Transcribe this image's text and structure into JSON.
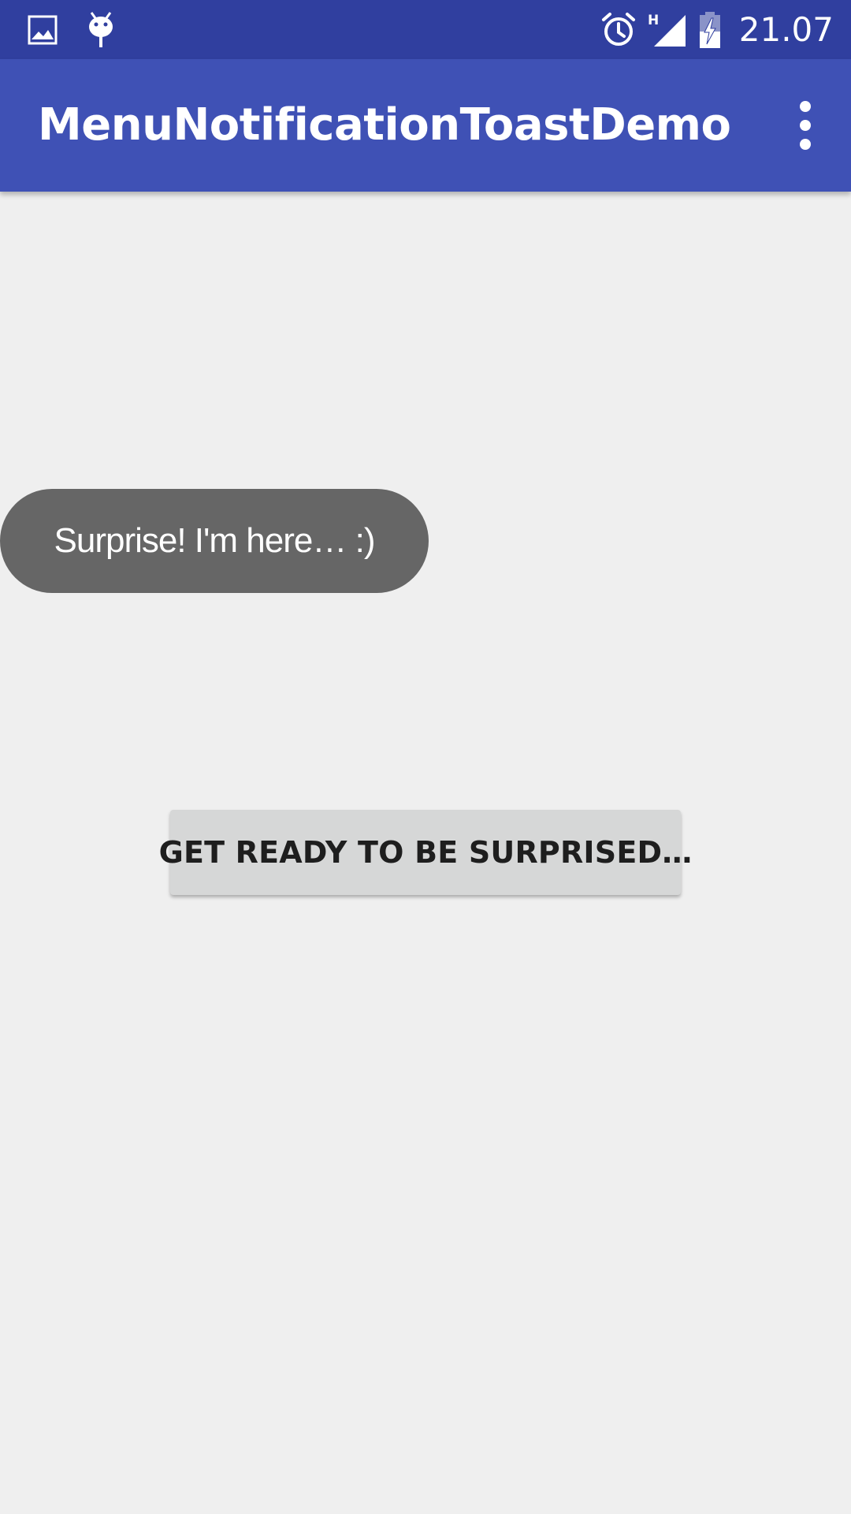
{
  "status_bar": {
    "time": "21.07",
    "network_label": "H",
    "left_icons": [
      "image-icon",
      "android-debug-icon"
    ],
    "right_icons": [
      "alarm-icon",
      "signal-icon",
      "battery-charging-icon"
    ],
    "background_color": "#303f9f"
  },
  "app_bar": {
    "title": "MenuNotificationToastDemo",
    "overflow_icon": "more-vert-icon",
    "background_color": "#3f51b5"
  },
  "toast": {
    "message": "Surprise! I'm here… :)",
    "background_color": "#666666"
  },
  "main": {
    "button_label": "GET READY TO BE SURPRISED…",
    "background_color": "#efefef"
  }
}
